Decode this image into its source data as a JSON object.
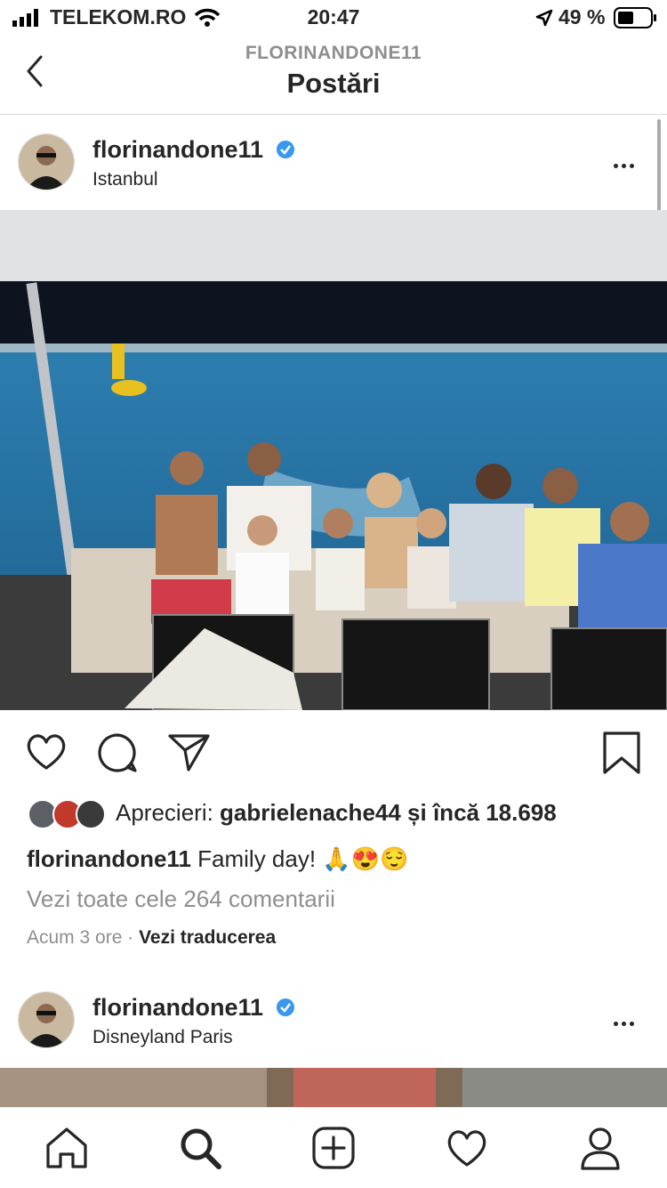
{
  "status_bar": {
    "carrier": "TELEKOM.RO",
    "time": "20:47",
    "battery": "49 %"
  },
  "header": {
    "username": "FLORINANDONE11",
    "title": "Postări"
  },
  "posts": [
    {
      "username": "florinandone11",
      "location": "Istanbul",
      "likes_prefix": "Aprecieri: ",
      "likes_user": "gabrielenache44",
      "likes_suffix": " și încă 18.698",
      "caption_user": "florinandone11",
      "caption_text": " Family day! 🙏😍😌",
      "comments_link": "Vezi toate cele 264 comentarii",
      "time_ago": "Acum 3 ore",
      "separator": " · ",
      "translate": "Vezi traducerea"
    },
    {
      "username": "florinandone11",
      "location": "Disneyland Paris"
    }
  ],
  "icons": {
    "verified": "verified-badge-icon",
    "like": "heart-icon",
    "comment": "comment-icon",
    "share": "paper-plane-icon",
    "save": "bookmark-icon",
    "tabs": [
      "home-icon",
      "search-icon",
      "add-icon",
      "activity-heart-icon",
      "profile-icon"
    ]
  },
  "colors": {
    "verified": "#3897f0",
    "text": "#262626",
    "muted": "#8e8e8e"
  }
}
